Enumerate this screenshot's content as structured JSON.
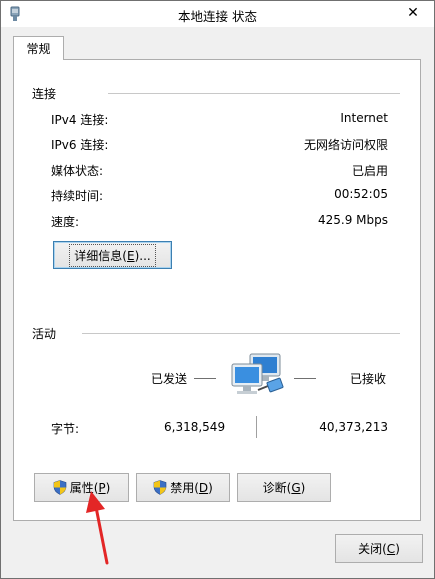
{
  "window": {
    "title": "本地连接 状态",
    "close_glyph": "✕"
  },
  "tabs": [
    {
      "label": "常规"
    }
  ],
  "connection": {
    "group_label": "连接",
    "rows": [
      {
        "label": "IPv4 连接:",
        "value": "Internet"
      },
      {
        "label": "IPv6 连接:",
        "value": "无网络访问权限"
      },
      {
        "label": "媒体状态:",
        "value": "已启用"
      },
      {
        "label": "持续时间:",
        "value": "00:52:05"
      },
      {
        "label": "速度:",
        "value": "425.9 Mbps"
      }
    ],
    "details_button": {
      "text": "详细信息(",
      "key": "E",
      "suffix": ")..."
    }
  },
  "activity": {
    "group_label": "活动",
    "sent_label": "已发送",
    "received_label": "已接收",
    "bytes_label": "字节:",
    "bytes_sent": "6,318,549",
    "bytes_received": "40,373,213"
  },
  "buttons": {
    "properties": {
      "text": "属性(",
      "key": "P",
      "suffix": ")"
    },
    "disable": {
      "text": "禁用(",
      "key": "D",
      "suffix": ")"
    },
    "diagnose": {
      "text": "诊断(",
      "key": "G",
      "suffix": ")"
    },
    "close": {
      "text": "关闭(",
      "key": "C",
      "suffix": ")"
    }
  },
  "colors": {
    "annotation_arrow": "#e32626",
    "focus_border": "#3c7fb1"
  }
}
